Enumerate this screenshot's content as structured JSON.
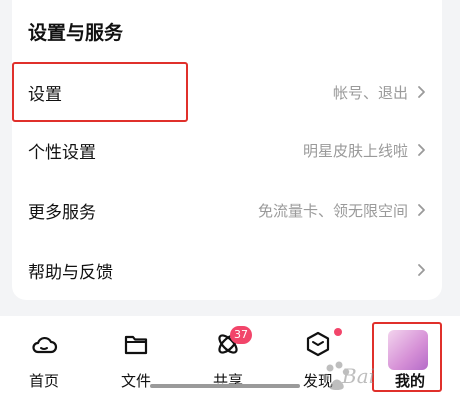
{
  "section": {
    "title": "设置与服务",
    "rows": [
      {
        "label": "设置",
        "hint": "帐号、退出"
      },
      {
        "label": "个性设置",
        "hint": "明星皮肤上线啦"
      },
      {
        "label": "更多服务",
        "hint": "免流量卡、领无限空间"
      },
      {
        "label": "帮助与反馈",
        "hint": ""
      }
    ]
  },
  "tabbar": {
    "tabs": [
      {
        "label": "首页",
        "icon": "cloud-icon"
      },
      {
        "label": "文件",
        "icon": "folder-icon"
      },
      {
        "label": "共享",
        "icon": "share-atom-icon",
        "badge": "37"
      },
      {
        "label": "发现",
        "icon": "cube-icon",
        "dot": true
      },
      {
        "label": "我的",
        "icon": "avatar"
      }
    ]
  },
  "watermark": {
    "text": "Bai"
  },
  "colors": {
    "highlight": "#e0302b",
    "badge": "#f2456a",
    "hint": "#9a9a9a",
    "background": "#f3f4f6"
  }
}
